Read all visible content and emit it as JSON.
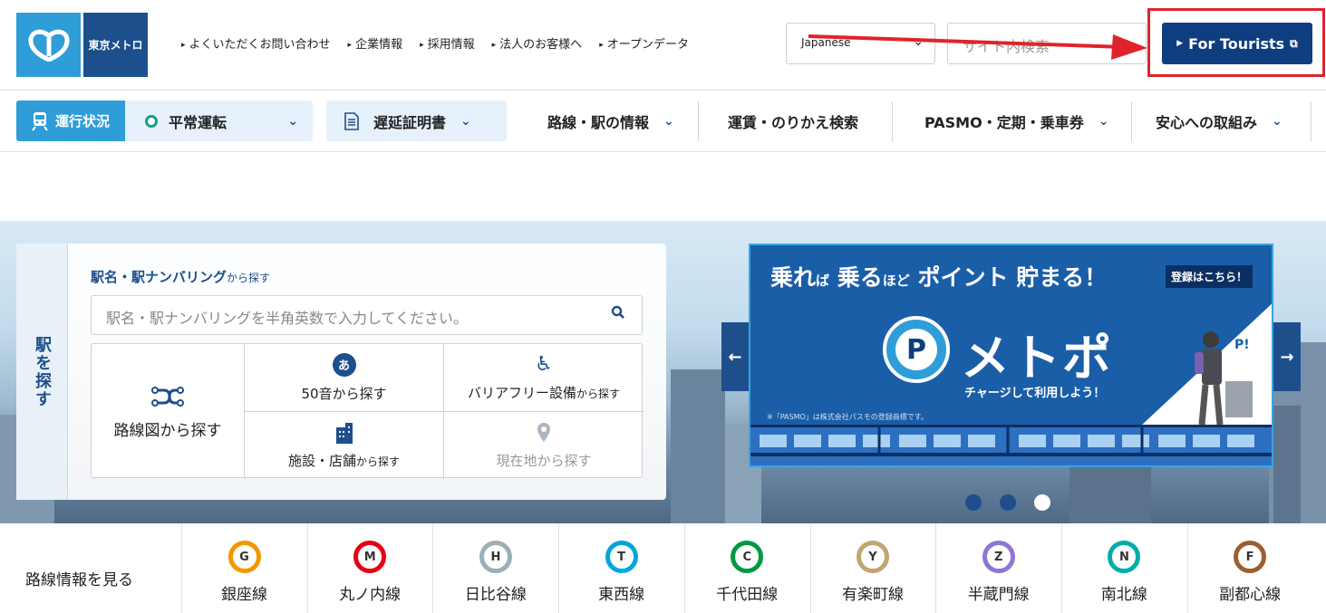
{
  "header": {
    "logo_text": "東京メトロ",
    "links": [
      "よくいただくお問い合わせ",
      "企業情報",
      "採用情報",
      "法人のお客様へ",
      "オープンデータ"
    ],
    "language": "Japanese",
    "search_placeholder": "サイト内検索",
    "tourists_button": "For Tourists"
  },
  "nav": {
    "status_label": "運行状況",
    "status_value": "平常運転",
    "delay_label": "遅延証明書",
    "items": [
      "路線・駅の情報",
      "運賃・のりかえ検索",
      "PASMO・定期・乗車券",
      "安心への取組み"
    ]
  },
  "finder": {
    "side_label": "駅を探す",
    "title": "駅名・駅ナンバリング",
    "title_suffix": "から探す",
    "input_placeholder": "駅名・駅ナンバリングを半角英数で入力してください。",
    "route_map": "路線図から探す",
    "kana_icon_char": "あ",
    "kana": "50音から探す",
    "barrier_free": "バリアフリー設備",
    "barrier_free_suffix": "から探す",
    "facility": "施設・店舗",
    "facility_suffix": "から探す",
    "location": "現在地から探す"
  },
  "banner": {
    "headline_1": "乗れ",
    "headline_2": "ば",
    "headline_3": "乗る",
    "headline_4": "ほど",
    "headline_5": "ポイント 貯まる！",
    "register": "登録はこちら！",
    "logo_letter": "P",
    "name": "メトポ",
    "sub": "チャージして利用しよう！",
    "note": "※「PASMO」は株式会社パスモの登録商標です。",
    "badge": "P!"
  },
  "lines": {
    "title": "路線情報を見る",
    "items": [
      {
        "code": "G",
        "name": "銀座線",
        "color": "#f39700"
      },
      {
        "code": "M",
        "name": "丸ノ内線",
        "color": "#e60012"
      },
      {
        "code": "H",
        "name": "日比谷線",
        "color": "#9caeb7"
      },
      {
        "code": "T",
        "name": "東西線",
        "color": "#00a7db"
      },
      {
        "code": "C",
        "name": "千代田線",
        "color": "#009944"
      },
      {
        "code": "Y",
        "name": "有楽町線",
        "color": "#c1a470"
      },
      {
        "code": "Z",
        "name": "半蔵門線",
        "color": "#8f76d6"
      },
      {
        "code": "N",
        "name": "南北線",
        "color": "#00ada9"
      },
      {
        "code": "F",
        "name": "副都心線",
        "color": "#9c5e31"
      }
    ]
  },
  "colors": {
    "accent_blue": "#2f9ed8",
    "navy": "#0f3e80",
    "highlight_red": "#e0232b",
    "status_green": "#12a08a"
  }
}
